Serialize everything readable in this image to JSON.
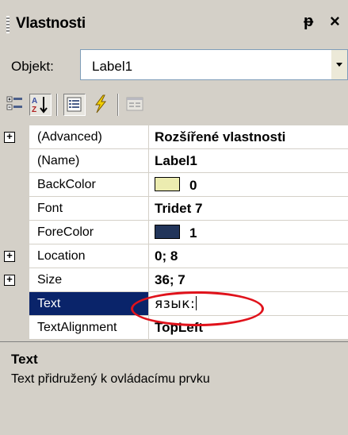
{
  "window": {
    "title": "Vlastnosti",
    "pin_glyph": "ᵽ",
    "close_glyph": "×"
  },
  "object_selector": {
    "label": "Objekt:",
    "value": "Label1"
  },
  "toolbar": {
    "buttons": [
      {
        "icon": "categorized-icon",
        "pressed": false
      },
      {
        "icon": "alphabetical-sort-icon",
        "pressed": true
      },
      {
        "icon": "properties-icon",
        "pressed": true
      },
      {
        "icon": "events-lightning-icon",
        "pressed": false
      },
      {
        "icon": "property-pages-icon",
        "pressed": false,
        "disabled": true
      }
    ]
  },
  "properties": [
    {
      "name": "(Advanced)",
      "value": "Rozšířené vlastnosti",
      "expandable": true
    },
    {
      "name": "(Name)",
      "value": "Label1"
    },
    {
      "name": "BackColor",
      "value": "0",
      "swatch": "#ececb0"
    },
    {
      "name": "Font",
      "value": "Tridet 7"
    },
    {
      "name": "ForeColor",
      "value": "1",
      "swatch": "#22355a"
    },
    {
      "name": "Location",
      "value": "0; 8",
      "expandable": true
    },
    {
      "name": "Size",
      "value": "36; 7",
      "expandable": true
    },
    {
      "name": "Text",
      "value": "язык:",
      "selected": true
    },
    {
      "name": "TextAlignment",
      "value": "TopLeft"
    }
  ],
  "description": {
    "title": "Text",
    "text": "Text přidružený k ovládacímu prvku"
  },
  "colors": {
    "selection": "#0a246a",
    "highlight_ellipse": "#e0121b",
    "panel": "#d4d0c8"
  }
}
